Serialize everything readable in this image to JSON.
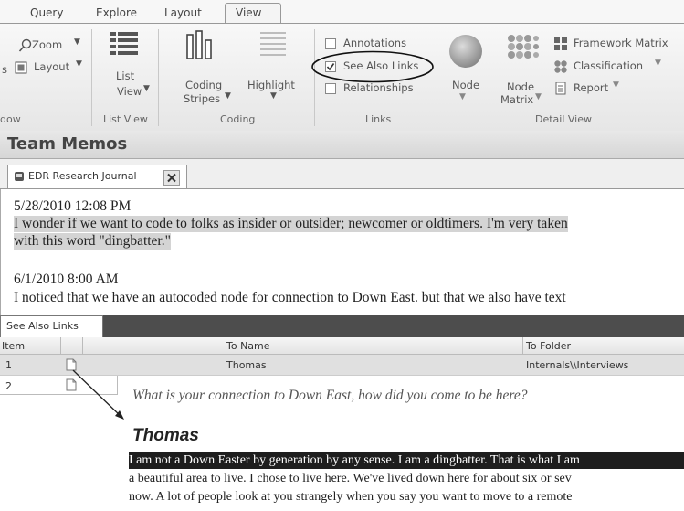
{
  "ribbon": {
    "tabs": [
      "Query",
      "Explore",
      "Layout",
      "View"
    ],
    "groups": {
      "window": {
        "zoom": "Zoom",
        "layout": "Layout",
        "label": "dow"
      },
      "list_view": {
        "list": "List",
        "view": "View",
        "label": "List View"
      },
      "coding": {
        "coding": "Coding",
        "stripes": "Stripes",
        "highlight": "Highlight",
        "label": "Coding"
      },
      "links": {
        "annotations": "Annotations",
        "see_also_links": "See Also Links",
        "relationships": "Relationships",
        "label": "Links"
      },
      "detail_view": {
        "node": "Node",
        "node2": "Node",
        "matrix": "Matrix",
        "framework_matrix": "Framework Matrix",
        "classification": "Classification",
        "report": "Report",
        "label": "Detail View"
      }
    },
    "side_letter": "s"
  },
  "memos": {
    "title": "Team Memos",
    "doc_tab": "EDR Research Journal"
  },
  "journal": [
    {
      "date": "5/28/2010 12:08 PM",
      "text1": "I wonder if we want to code to folks as insider or outsider; newcomer or oldtimers. I'm very taken",
      "text2": "with this word \"dingbatter.\""
    },
    {
      "date": "6/1/2010 8:00 AM",
      "text1": "I noticed that we have an autocoded node for connection to Down East. but that we also have text"
    }
  ],
  "see_also": {
    "tab": "See Also Links",
    "headers": {
      "item": "Item",
      "to_name": "To Name",
      "to_folder": "To Folder"
    },
    "rows": [
      {
        "item": "1",
        "to_name": "Thomas",
        "to_folder": "Internals\\\\Interviews"
      },
      {
        "item": "2",
        "to_name": "",
        "to_folder": ""
      }
    ]
  },
  "popup": {
    "question": "What is your connection to Down East, how did you come to be here?",
    "name": "Thomas",
    "lines": [
      "I am not a Down Easter by generation by any sense. I am a dingbatter. That is what I am",
      "a beautiful area to live. I chose to live here. We've lived down here for about six or sev",
      "now. A lot of people look at you strangely when you say you want to move to a remote"
    ]
  }
}
